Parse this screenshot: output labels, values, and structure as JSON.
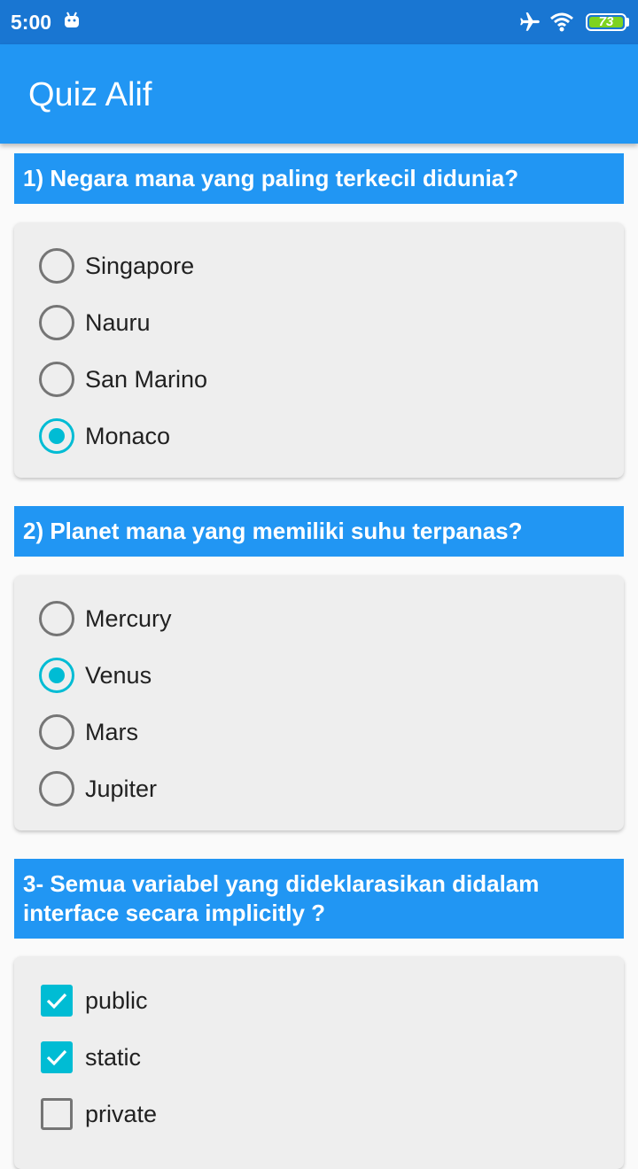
{
  "status_bar": {
    "time": "5:00",
    "battery": "73",
    "icons": [
      "android-icon",
      "airplane-mode-icon",
      "wifi-icon",
      "battery-icon"
    ]
  },
  "app_bar": {
    "title": "Quiz Alif"
  },
  "questions": [
    {
      "text": "1) Negara mana yang paling terkecil didunia?",
      "type": "radio",
      "options": [
        {
          "label": "Singapore",
          "checked": false
        },
        {
          "label": "Nauru",
          "checked": false
        },
        {
          "label": "San Marino",
          "checked": false
        },
        {
          "label": "Monaco",
          "checked": true
        }
      ]
    },
    {
      "text": "2) Planet mana yang memiliki suhu terpanas?",
      "type": "radio",
      "options": [
        {
          "label": "Mercury",
          "checked": false
        },
        {
          "label": "Venus",
          "checked": true
        },
        {
          "label": "Mars",
          "checked": false
        },
        {
          "label": "Jupiter",
          "checked": false
        }
      ]
    },
    {
      "text": "3- Semua variabel yang dideklarasikan didalam interface secara implicitly ?",
      "type": "checkbox",
      "options": [
        {
          "label": "public",
          "checked": true
        },
        {
          "label": "static",
          "checked": true
        },
        {
          "label": "private",
          "checked": false
        }
      ]
    }
  ],
  "colors": {
    "status_bar": "#1976d2",
    "app_bar": "#2196f3",
    "accent": "#00bcd4",
    "card": "#eeeeee"
  }
}
